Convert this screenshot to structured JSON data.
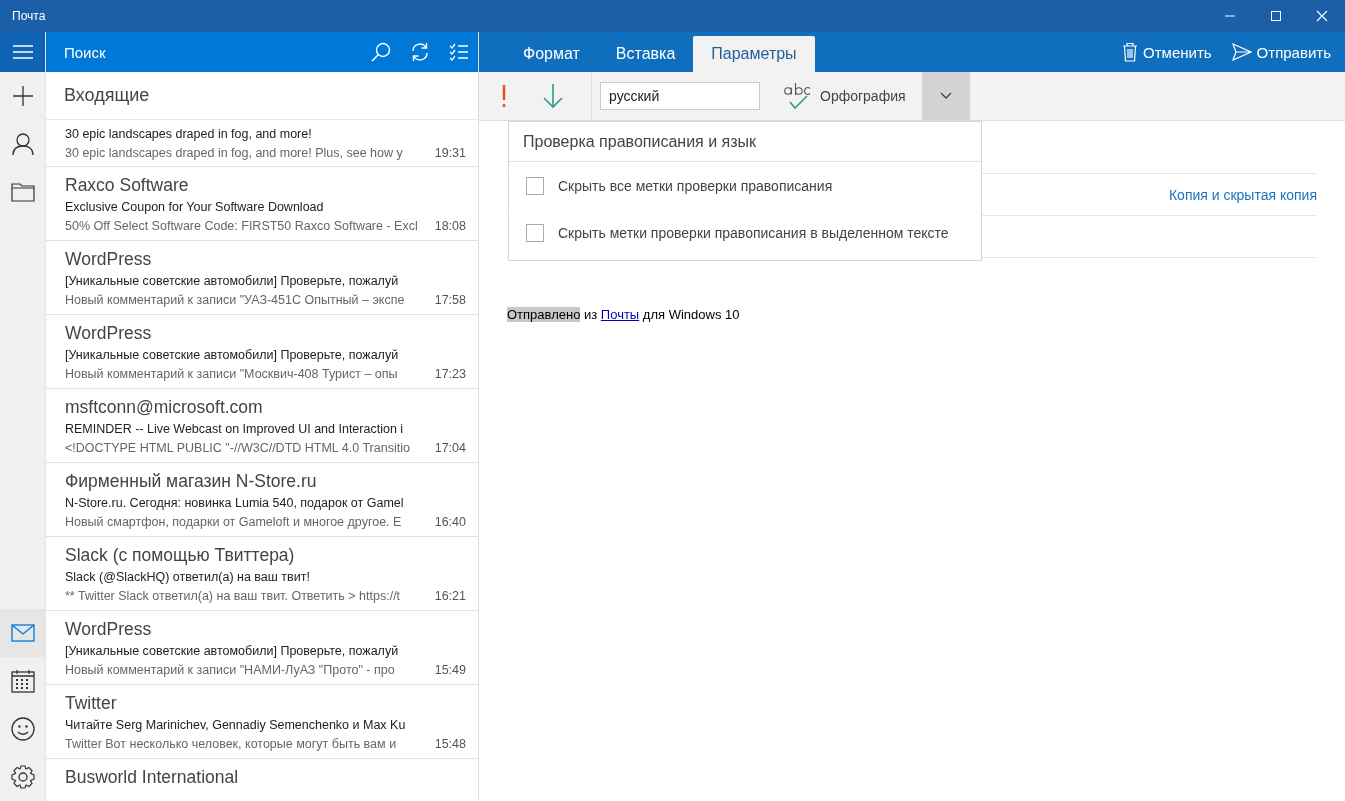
{
  "window": {
    "title": "Почта",
    "controls": [
      {
        "kind": "minimize"
      },
      {
        "kind": "maximize"
      },
      {
        "kind": "close"
      }
    ]
  },
  "rail": {
    "top": [
      {
        "kind": "menu",
        "selected": false
      },
      {
        "kind": "new",
        "selected": false
      },
      {
        "kind": "accounts",
        "selected": false
      },
      {
        "kind": "folders",
        "selected": false
      }
    ],
    "bottom": [
      {
        "kind": "mail",
        "selected": true
      },
      {
        "kind": "calendar",
        "selected": false
      },
      {
        "kind": "feedback",
        "selected": false
      },
      {
        "kind": "settings",
        "selected": false
      }
    ]
  },
  "list_header": {
    "search": {
      "placeholder": "Поиск"
    },
    "actions": [
      {
        "kind": "search"
      },
      {
        "kind": "sync"
      },
      {
        "kind": "select"
      }
    ]
  },
  "folder": "Входящие",
  "messages": [
    {
      "subject": "30 epic landscapes draped in fog, and more!",
      "preview": "30 epic landscapes draped in fog, and more! Plus, see how y",
      "time": "19:31"
    },
    {
      "sender": "Raxco Software",
      "subject": "Exclusive Coupon for Your Software Download",
      "preview": "50% Off Select Software Code: FIRST50 Raxco Software - Excl",
      "time": "18:08"
    },
    {
      "sender": "WordPress",
      "subject": "[Уникальные советские автомобили] Проверьте, пожалуй",
      "preview": "Новый комментарий к записи \"УАЗ-451С Опытный – экспе",
      "time": "17:58"
    },
    {
      "sender": "WordPress",
      "subject": "[Уникальные советские автомобили] Проверьте, пожалуй",
      "preview": "Новый комментарий к записи \"Москвич-408 Турист – опы",
      "time": "17:23"
    },
    {
      "sender": "msftconn@microsoft.com",
      "subject": "REMINDER -- Live Webcast on Improved UI and Interaction i",
      "preview": "<!DOCTYPE HTML PUBLIC \"-//W3C//DTD HTML 4.0 Transitio",
      "time": "17:04"
    },
    {
      "sender": "Фирменный магазин N-Store.ru",
      "subject": "N-Store.ru. Сегодня: новинка Lumia 540, подарок от Gamel",
      "preview": "Новый смартфон, подарки от Gameloft и многое другое. Е",
      "time": "16:40"
    },
    {
      "sender": "Slack (с помощью Твиттера)",
      "subject": "Slack (@SlackHQ) ответил(а) на ваш твит!",
      "preview": "** Twitter Slack ответил(а) на ваш твит. Ответить > https://t",
      "time": "16:21"
    },
    {
      "sender": "WordPress",
      "subject": "[Уникальные советские автомобили] Проверьте, пожалуй",
      "preview": "Новый комментарий к записи \"НАМИ-ЛуАЗ \"Прото\" - про",
      "time": "15:49"
    },
    {
      "sender": "Twitter",
      "subject": "Читайте Serg Marinichev, Gennadiy Semenchenko и Max Ku",
      "preview": "Twitter Вот несколько человек, которые могут быть вам и",
      "time": "15:48"
    },
    {
      "sender": "Busworld International"
    }
  ],
  "tabs": [
    {
      "label": "Формат",
      "selected": false
    },
    {
      "label": "Вставка",
      "selected": false
    },
    {
      "label": "Параметры",
      "selected": true
    }
  ],
  "compose_actions": [
    {
      "kind": "discard",
      "label": "Отменить"
    },
    {
      "kind": "send",
      "label": "Отправить"
    }
  ],
  "toolbar": {
    "language": "русский",
    "spelling": "Орфография",
    "more_expanded": true
  },
  "spell_menu": {
    "title": "Проверка правописания и язык",
    "options": [
      {
        "label": "Скрыть все метки проверки правописания",
        "checked": false
      },
      {
        "label": "Скрыть метки проверки правописания в выделенном тексте",
        "checked": false
      }
    ]
  },
  "cc_bcc_link": "Копия и скрытая копия",
  "signature": {
    "selected_text": "Отправлено",
    "before_link": " из ",
    "link": "Почты",
    "after_link": " для Windows 10"
  }
}
